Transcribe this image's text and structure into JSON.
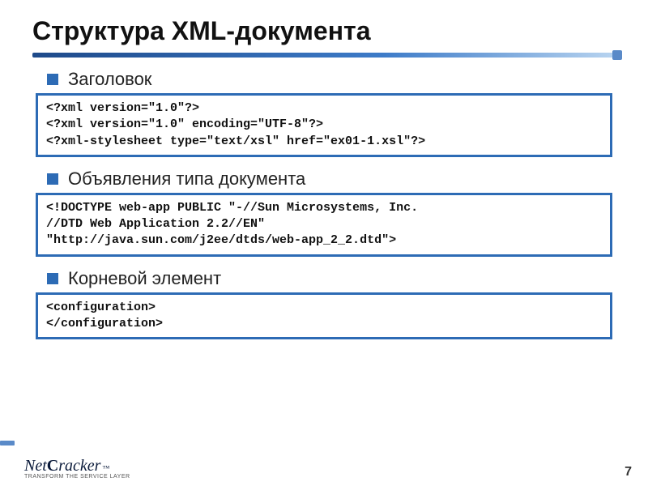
{
  "title": "Структура XML-документа",
  "sections": [
    {
      "label": "Заголовок",
      "code": "<?xml version=\"1.0\"?>\n<?xml version=\"1.0\" encoding=\"UTF-8\"?>\n<?xml-stylesheet type=\"text/xsl\" href=\"ex01-1.xsl\"?>"
    },
    {
      "label": "Объявления типа документа",
      "code": "<!DOCTYPE web-app PUBLIC \"-//Sun Microsystems, Inc.\n//DTD Web Application 2.2//EN\"\n\"http://java.sun.com/j2ee/dtds/web-app_2_2.dtd\">"
    },
    {
      "label": "Корневой элемент",
      "code": "<configuration>\n</configuration>"
    }
  ],
  "footer": {
    "logo_net": "Net",
    "logo_c": "C",
    "logo_racker": "racker",
    "logo_tm": "™",
    "logo_tagline": "TRANSFORM THE SERVICE LAYER",
    "page_number": "7"
  }
}
